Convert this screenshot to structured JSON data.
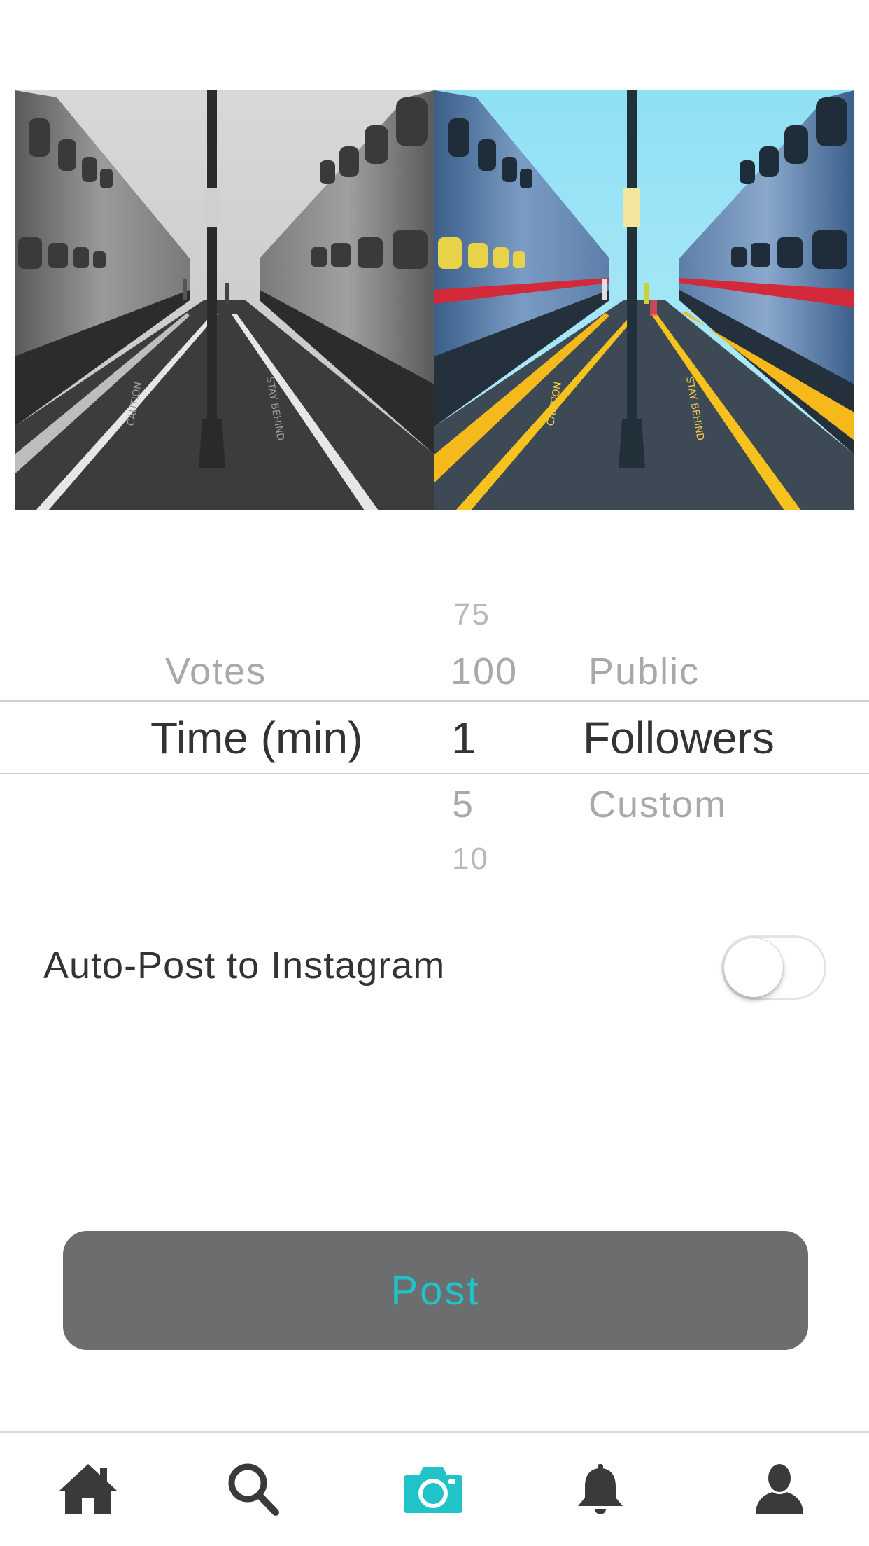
{
  "photos": {
    "left_label": "",
    "right_label": ""
  },
  "picker": {
    "column_1": {
      "items": [
        "Votes",
        "Time (min)"
      ],
      "selected": "Time (min)"
    },
    "column_2": {
      "items": [
        "75",
        "100",
        "1",
        "5",
        "10"
      ],
      "selected": "1"
    },
    "column_3": {
      "items": [
        "Public",
        "Followers",
        "Custom"
      ],
      "selected": "Followers"
    }
  },
  "instagram_toggle": {
    "label": "Auto-Post to Instagram",
    "on": false
  },
  "post_button": {
    "label": "Post"
  },
  "tab_bar": {
    "items": [
      {
        "icon": "home-icon",
        "selected": false
      },
      {
        "icon": "search-icon",
        "selected": false
      },
      {
        "icon": "camera-icon",
        "selected": true
      },
      {
        "icon": "bell-icon",
        "selected": false
      },
      {
        "icon": "profile-icon",
        "selected": false
      }
    ]
  },
  "colors": {
    "accent": "#1fc3c8",
    "icon_default": "#3a3a3a",
    "button_bg": "#6c6d6f"
  }
}
